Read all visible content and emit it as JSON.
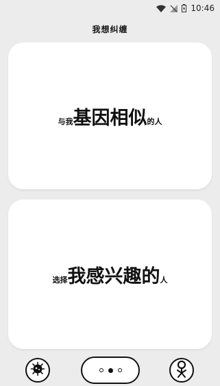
{
  "status_bar": {
    "time": "10:46",
    "icons": [
      "wifi-icon",
      "signal-icon",
      "battery-icon"
    ]
  },
  "header": {
    "title": "我想纠缠"
  },
  "cards": [
    {
      "parts": [
        {
          "text": "与我",
          "size": "small"
        },
        {
          "text": "基因相似",
          "size": "big"
        },
        {
          "text": "的人",
          "size": "small"
        }
      ]
    },
    {
      "parts": [
        {
          "text": "选择",
          "size": "small"
        },
        {
          "text": "我感兴趣的",
          "size": "big"
        },
        {
          "text": "人",
          "size": "small"
        }
      ]
    }
  ],
  "bottom_nav": {
    "left_icon": "virus-icon",
    "center_icon": "dots-icon",
    "right_icon": "person-icon"
  },
  "colors": {
    "background": "#ececec",
    "card": "#ffffff",
    "text": "#111111"
  }
}
